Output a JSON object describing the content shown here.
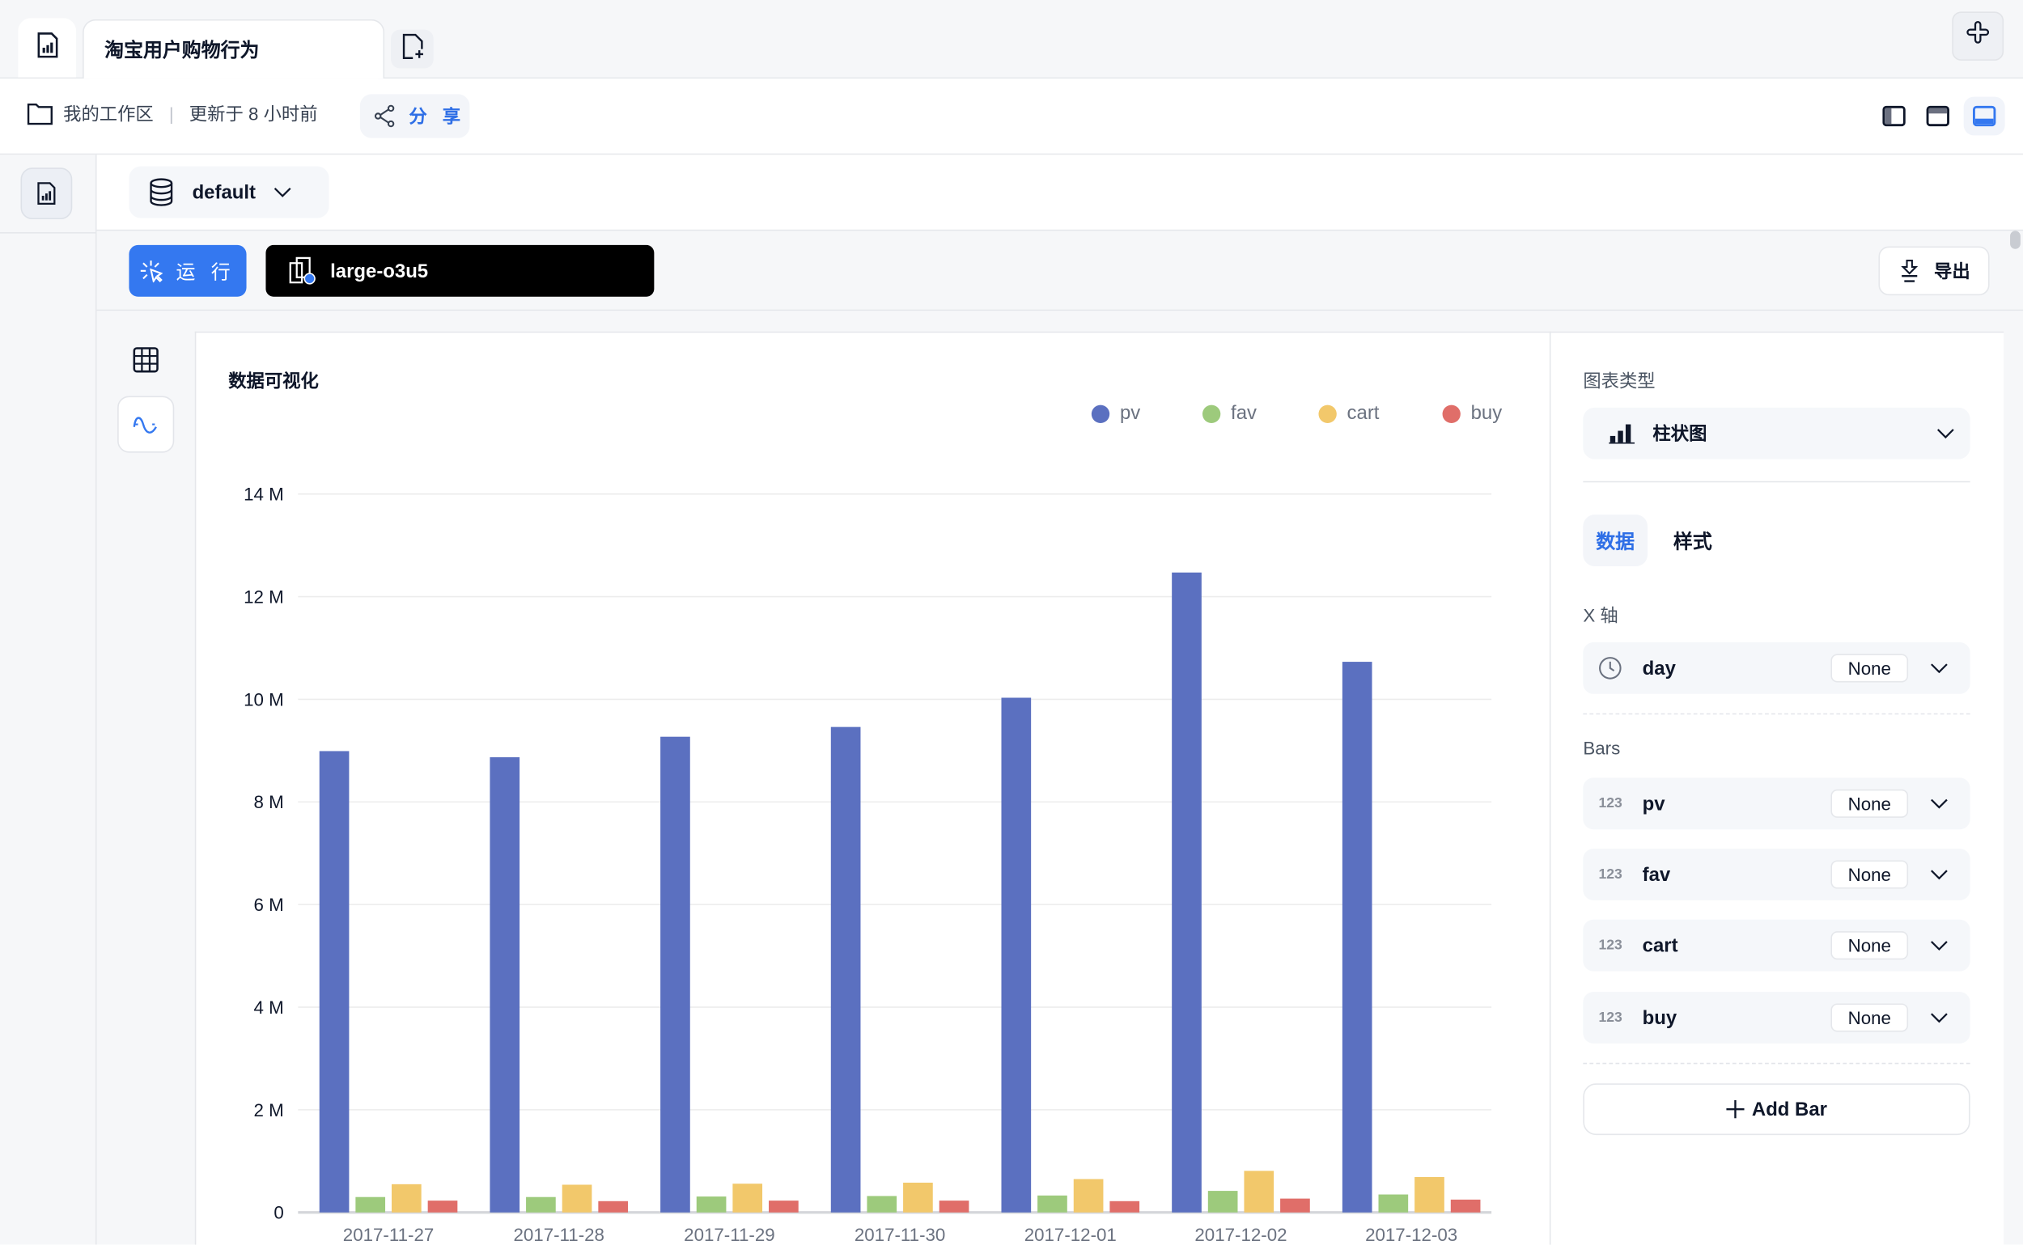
{
  "tabs": {
    "home_icon": "report-icon",
    "active_tab_title": "淘宝用户购物行为",
    "new_tab_icon": "file-plus-icon",
    "plugin_icon": "puzzle-icon"
  },
  "breadcrumb": {
    "workspace": "我的工作区",
    "separator": "|",
    "updated": "更新于 8 小时前",
    "share_label": "分 享"
  },
  "layout_toggles": [
    {
      "name": "left-panel",
      "active": false
    },
    {
      "name": "top-panel",
      "active": false
    },
    {
      "name": "bottom-panel",
      "active": true
    }
  ],
  "database": {
    "selected": "default"
  },
  "toolbar": {
    "run_label": "运 行",
    "connection_name": "large-o3u5",
    "export_label": "导出"
  },
  "chart_panel": {
    "title": "数据可视化"
  },
  "config": {
    "chart_type_label": "图表类型",
    "chart_type_value": "柱状图",
    "tabs": [
      {
        "label": "数据",
        "active": true
      },
      {
        "label": "样式",
        "active": false
      }
    ],
    "x_axis_label": "X 轴",
    "x_field": {
      "type_icon": "clock-icon",
      "name": "day",
      "agg": "None"
    },
    "bars_label": "Bars",
    "bars": [
      {
        "type_icon": "123",
        "name": "pv",
        "agg": "None"
      },
      {
        "type_icon": "123",
        "name": "fav",
        "agg": "None"
      },
      {
        "type_icon": "123",
        "name": "cart",
        "agg": "None"
      },
      {
        "type_icon": "123",
        "name": "buy",
        "agg": "None"
      }
    ],
    "add_bar_label": "Add Bar"
  },
  "colors": {
    "accent": "#3478f0",
    "pv": "#5b70c0",
    "fav": "#9dca7c",
    "cart": "#f2c86b",
    "buy": "#e06e69"
  },
  "chart_data": {
    "type": "bar",
    "title": "数据可视化",
    "categories": [
      "2017-11-27",
      "2017-11-28",
      "2017-11-29",
      "2017-11-30",
      "2017-12-01",
      "2017-12-02",
      "2017-12-03"
    ],
    "series": [
      {
        "name": "pv",
        "color": "#5b70c0",
        "values": [
          8990000,
          8870000,
          9270000,
          9460000,
          10030000,
          12470000,
          10730000
        ]
      },
      {
        "name": "fav",
        "color": "#9dca7c",
        "values": [
          300000,
          300000,
          310000,
          320000,
          330000,
          420000,
          350000
        ]
      },
      {
        "name": "cart",
        "color": "#f2c86b",
        "values": [
          550000,
          540000,
          560000,
          580000,
          650000,
          810000,
          690000
        ]
      },
      {
        "name": "buy",
        "color": "#e06e69",
        "values": [
          230000,
          220000,
          230000,
          230000,
          220000,
          270000,
          250000
        ]
      }
    ],
    "xlabel": "",
    "ylabel": "",
    "ylim": [
      0,
      14000000
    ],
    "yticks": [
      0,
      2000000,
      4000000,
      6000000,
      8000000,
      10000000,
      12000000,
      14000000
    ],
    "ytick_labels": [
      "0",
      "2 M",
      "4 M",
      "6 M",
      "8 M",
      "10 M",
      "12 M",
      "14 M"
    ],
    "grid": true,
    "legend_position": "top-right"
  }
}
